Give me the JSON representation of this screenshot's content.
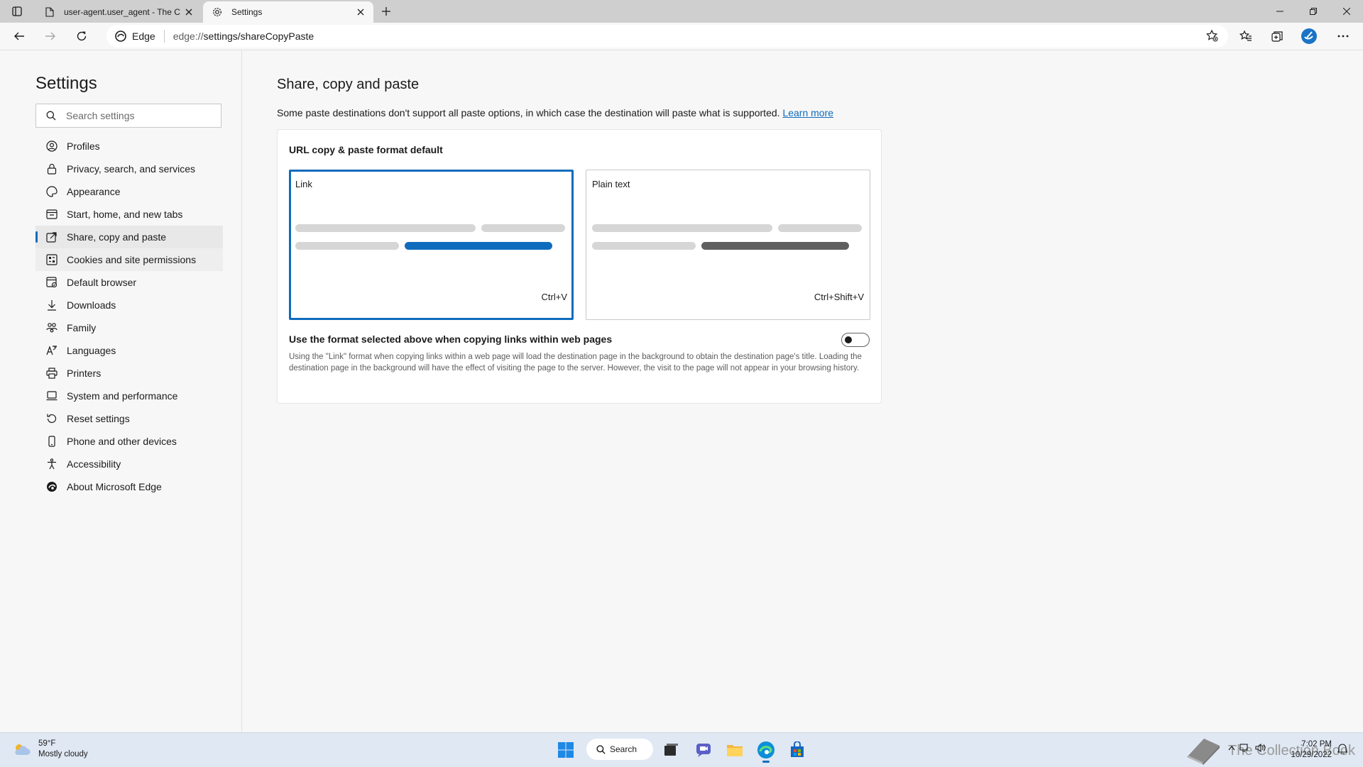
{
  "browser": {
    "tabs": [
      {
        "title": "user-agent.user_agent - The Coll",
        "active": false,
        "icon": "document-icon"
      },
      {
        "title": "Settings",
        "active": true,
        "icon": "gear-icon"
      }
    ],
    "address": {
      "chip_label": "Edge",
      "url_host": "edge://",
      "url_path": "settings/shareCopyPaste"
    }
  },
  "sidebar": {
    "title": "Settings",
    "search_placeholder": "Search settings",
    "items": [
      {
        "label": "Profiles",
        "icon": "profile-icon"
      },
      {
        "label": "Privacy, search, and services",
        "icon": "lock-icon"
      },
      {
        "label": "Appearance",
        "icon": "palette-icon"
      },
      {
        "label": "Start, home, and new tabs",
        "icon": "window-icon"
      },
      {
        "label": "Share, copy and paste",
        "icon": "share-icon",
        "selected": true
      },
      {
        "label": "Cookies and site permissions",
        "icon": "cookies-icon"
      },
      {
        "label": "Default browser",
        "icon": "browser-icon"
      },
      {
        "label": "Downloads",
        "icon": "download-icon"
      },
      {
        "label": "Family",
        "icon": "family-icon"
      },
      {
        "label": "Languages",
        "icon": "languages-icon"
      },
      {
        "label": "Printers",
        "icon": "printer-icon"
      },
      {
        "label": "System and performance",
        "icon": "laptop-icon"
      },
      {
        "label": "Reset settings",
        "icon": "reset-icon"
      },
      {
        "label": "Phone and other devices",
        "icon": "phone-icon"
      },
      {
        "label": "Accessibility",
        "icon": "accessibility-icon"
      },
      {
        "label": "About Microsoft Edge",
        "icon": "edge-logo-icon"
      }
    ]
  },
  "main": {
    "title": "Share, copy and paste",
    "description": "Some paste destinations don't support all paste options, in which case the destination will paste what is supported.",
    "learn_more": "Learn more",
    "card": {
      "heading": "URL copy & paste format default",
      "options": [
        {
          "label": "Link",
          "shortcut": "Ctrl+V",
          "selected": true
        },
        {
          "label": "Plain text",
          "shortcut": "Ctrl+Shift+V",
          "selected": false
        }
      ],
      "toggle_label": "Use the format selected above when copying links within web pages",
      "toggle_on": false,
      "toggle_description": "Using the \"Link\" format when copying links within a web page will load the destination page in the background to obtain the destination page's title. Loading the destination page in the background will have the effect of visiting the page to the server. However, the visit to the page will not appear in your browsing history."
    }
  },
  "taskbar": {
    "weather_temp": "59°F",
    "weather_desc": "Mostly cloudy",
    "search_label": "Search",
    "watermark": "The Collection Book",
    "time": "7:02 PM",
    "date": "10/29/2022"
  },
  "colors": {
    "accent": "#0f6cbd",
    "selected_nav_bg": "#e8e8e8",
    "dark_bar": "#5f5f5f"
  }
}
